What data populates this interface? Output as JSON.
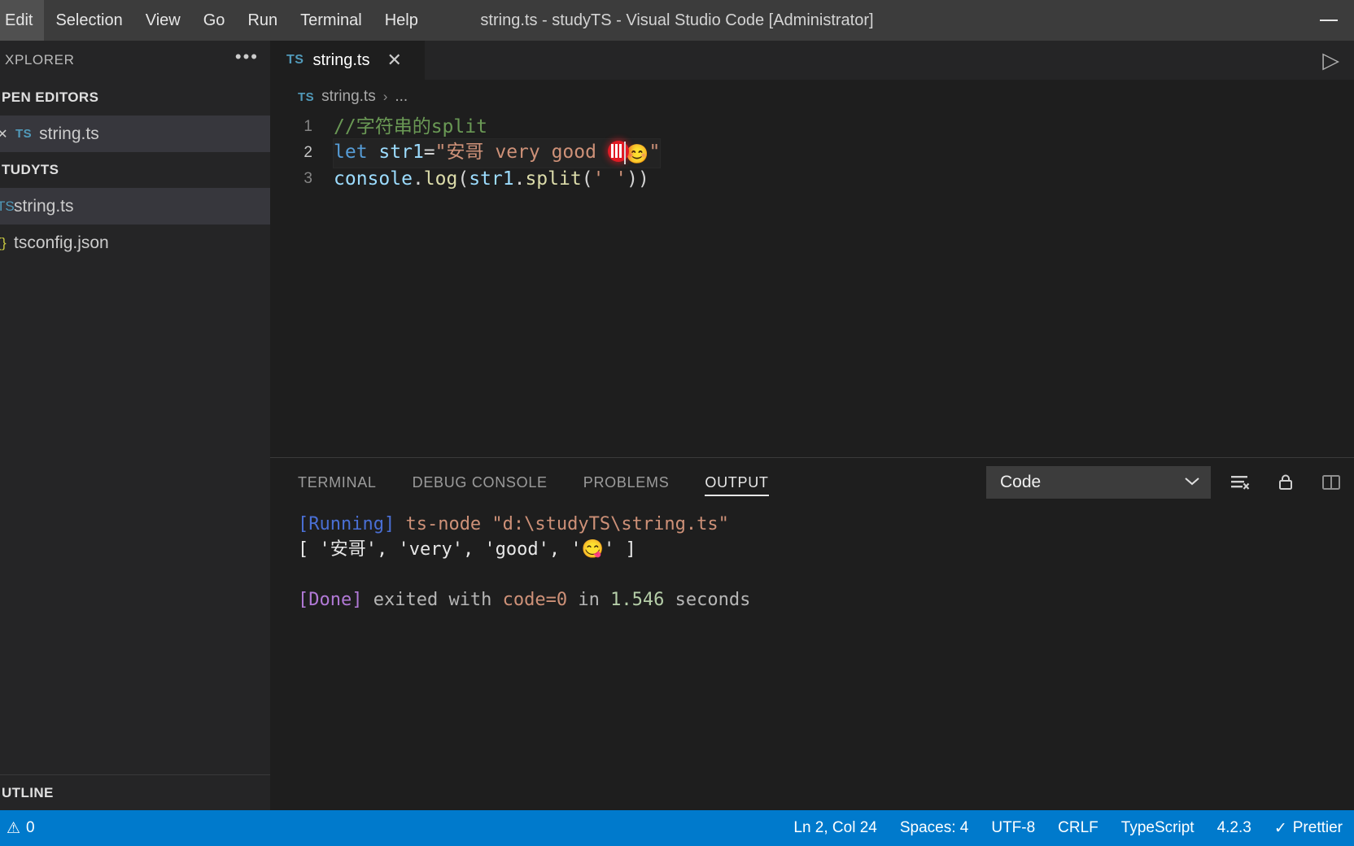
{
  "titlebar": {
    "menu": [
      "Edit",
      "Selection",
      "View",
      "Go",
      "Run",
      "Terminal",
      "Help"
    ],
    "title": "string.ts - studyTS - Visual Studio Code [Administrator]",
    "minimize_label": "—"
  },
  "sidebar": {
    "header": "XPLORER",
    "more_icon": "•••",
    "open_editors": {
      "label": "PEN EDITORS",
      "items": [
        {
          "chevron": "✕",
          "badge": "TS",
          "label": "string.ts",
          "selected": true
        }
      ]
    },
    "folder": {
      "label": "TUDYTS",
      "items": [
        {
          "glyph": "TS",
          "label": "string.ts",
          "kind": "ts",
          "selected": true
        },
        {
          "glyph": "{}",
          "label": "tsconfig.json",
          "kind": "json",
          "selected": false
        }
      ]
    },
    "outline": "UTLINE"
  },
  "tabbar": {
    "tabs": [
      {
        "badge": "TS",
        "label": "string.ts",
        "close": "✕",
        "active": true
      }
    ],
    "run_icon": "▷"
  },
  "breadcrumbs": {
    "badge": "TS",
    "file": "string.ts",
    "separator": "›",
    "trailing": "..."
  },
  "editor": {
    "lines": [
      {
        "num": "1",
        "current": false,
        "segments": [
          {
            "cls": "c-comment",
            "text": "//字符串的split"
          }
        ]
      },
      {
        "num": "2",
        "current": true,
        "segments": [
          {
            "cls": "c-kw",
            "text": "let"
          },
          {
            "cls": "c-op",
            "text": " "
          },
          {
            "cls": "c-var",
            "text": "str1"
          },
          {
            "cls": "c-op",
            "text": "="
          },
          {
            "cls": "c-str",
            "text": "\"安哥 very good "
          },
          {
            "cls": "rec",
            "text": ""
          },
          {
            "cls": "caret",
            "text": ""
          },
          {
            "cls": "emoji",
            "text": "😊"
          },
          {
            "cls": "c-str",
            "text": "\""
          }
        ]
      },
      {
        "num": "3",
        "current": false,
        "segments": [
          {
            "cls": "c-var",
            "text": "console"
          },
          {
            "cls": "c-punc",
            "text": "."
          },
          {
            "cls": "c-fn",
            "text": "log"
          },
          {
            "cls": "c-punc",
            "text": "("
          },
          {
            "cls": "c-var",
            "text": "str1"
          },
          {
            "cls": "c-punc",
            "text": "."
          },
          {
            "cls": "c-fn",
            "text": "split"
          },
          {
            "cls": "c-punc",
            "text": "("
          },
          {
            "cls": "c-str",
            "text": "' '"
          },
          {
            "cls": "c-punc",
            "text": "))"
          }
        ]
      }
    ]
  },
  "panel": {
    "tabs": [
      {
        "label": "TERMINAL",
        "active": false
      },
      {
        "label": "DEBUG CONSOLE",
        "active": false
      },
      {
        "label": "PROBLEMS",
        "active": false
      },
      {
        "label": "OUTPUT",
        "active": true
      }
    ],
    "channel_select": {
      "value": "Code",
      "chevron": "⌄"
    },
    "actions": [
      {
        "name": "clear-output-icon",
        "glyph": "clear"
      },
      {
        "name": "lock-icon",
        "glyph": "lock"
      },
      {
        "name": "split-panel-icon",
        "glyph": "split"
      }
    ],
    "output": {
      "running_tag": "[Running]",
      "running_cmd": " ts-node \"d:\\studyTS\\string.ts\"",
      "result_line": "[ '安哥', 'very', 'good', '😋' ]",
      "done_tag": "[Done]",
      "done_mid": " exited with ",
      "done_code": "code=0",
      "done_in": " in ",
      "done_seconds": "1.546",
      "done_unit": " seconds"
    }
  },
  "statusbar": {
    "left": [
      {
        "icon": "⚠",
        "label": "0"
      }
    ],
    "right": [
      {
        "label": "Ln 2, Col 24"
      },
      {
        "label": "Spaces: 4"
      },
      {
        "label": "UTF-8"
      },
      {
        "label": "CRLF"
      },
      {
        "label": "TypeScript"
      },
      {
        "label": "4.2.3"
      },
      {
        "icon": "✓",
        "label": "Prettier"
      }
    ]
  },
  "colors": {
    "titlebar_bg": "#3c3c3c",
    "sidebar_bg": "#252526",
    "editor_bg": "#1e1e1e",
    "status_bg": "#007acc",
    "accent_ts": "#519aba"
  }
}
